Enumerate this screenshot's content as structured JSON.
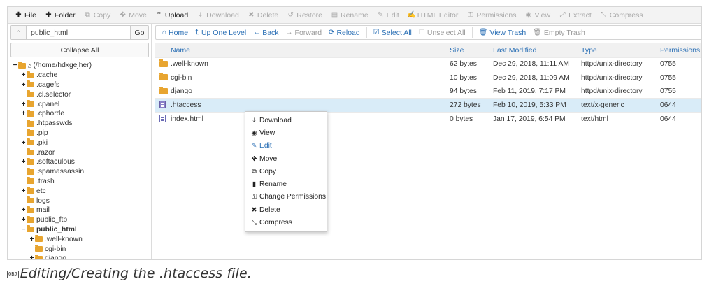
{
  "toolbar": {
    "items": [
      {
        "label": "File",
        "icon": "plus-icon",
        "glyph": "✚",
        "active": true
      },
      {
        "label": "Folder",
        "icon": "plus-icon",
        "glyph": "✚",
        "active": true
      },
      {
        "label": "Copy",
        "icon": "copy-icon",
        "glyph": "⧉",
        "active": false
      },
      {
        "label": "Move",
        "icon": "move-icon",
        "glyph": "✥",
        "active": false
      },
      {
        "label": "Upload",
        "icon": "upload-icon",
        "glyph": "⤒",
        "active": true
      },
      {
        "label": "Download",
        "icon": "download-icon",
        "glyph": "⤓",
        "active": false
      },
      {
        "label": "Delete",
        "icon": "delete-icon",
        "glyph": "✖",
        "active": false
      },
      {
        "label": "Restore",
        "icon": "restore-icon",
        "glyph": "↺",
        "active": false
      },
      {
        "label": "Rename",
        "icon": "rename-icon",
        "glyph": "▤",
        "active": false
      },
      {
        "label": "Edit",
        "icon": "edit-icon",
        "glyph": "✎",
        "active": false
      },
      {
        "label": "HTML Editor",
        "icon": "html-editor-icon",
        "glyph": "✍",
        "active": false
      },
      {
        "label": "Permissions",
        "icon": "key-icon",
        "glyph": "⚿",
        "active": false
      },
      {
        "label": "View",
        "icon": "eye-icon",
        "glyph": "◉",
        "active": false
      },
      {
        "label": "Extract",
        "icon": "extract-icon",
        "glyph": "⤢",
        "active": false
      },
      {
        "label": "Compress",
        "icon": "compress-icon",
        "glyph": "⤡",
        "active": false
      }
    ]
  },
  "left": {
    "path_value": "public_html",
    "go_label": "Go",
    "collapse_label": "Collapse All",
    "tree": [
      {
        "label": "(/home/hdxgejher)",
        "toggle": "−",
        "level": 0,
        "home": true,
        "bold": false
      },
      {
        "label": ".cache",
        "toggle": "+",
        "level": 1,
        "bold": false
      },
      {
        "label": ".cagefs",
        "toggle": "+",
        "level": 1,
        "bold": false
      },
      {
        "label": ".cl.selector",
        "toggle": "",
        "level": 1,
        "bold": false
      },
      {
        "label": ".cpanel",
        "toggle": "+",
        "level": 1,
        "bold": false
      },
      {
        "label": ".cphorde",
        "toggle": "+",
        "level": 1,
        "bold": false
      },
      {
        "label": ".htpasswds",
        "toggle": "",
        "level": 1,
        "bold": false
      },
      {
        "label": ".pip",
        "toggle": "",
        "level": 1,
        "bold": false
      },
      {
        "label": ".pki",
        "toggle": "+",
        "level": 1,
        "bold": false
      },
      {
        "label": ".razor",
        "toggle": "",
        "level": 1,
        "bold": false
      },
      {
        "label": ".softaculous",
        "toggle": "+",
        "level": 1,
        "bold": false
      },
      {
        "label": ".spamassassin",
        "toggle": "",
        "level": 1,
        "bold": false
      },
      {
        "label": ".trash",
        "toggle": "",
        "level": 1,
        "bold": false
      },
      {
        "label": "etc",
        "toggle": "+",
        "level": 1,
        "bold": false
      },
      {
        "label": "logs",
        "toggle": "",
        "level": 1,
        "bold": false
      },
      {
        "label": "mail",
        "toggle": "+",
        "level": 1,
        "bold": false
      },
      {
        "label": "public_ftp",
        "toggle": "+",
        "level": 1,
        "bold": false
      },
      {
        "label": "public_html",
        "toggle": "−",
        "level": 1,
        "bold": true
      },
      {
        "label": ".well-known",
        "toggle": "+",
        "level": 2,
        "bold": false
      },
      {
        "label": "cgi-bin",
        "toggle": "",
        "level": 2,
        "bold": false
      },
      {
        "label": "django",
        "toggle": "+",
        "level": 2,
        "bold": false
      }
    ]
  },
  "nav": {
    "items": [
      {
        "label": "Home",
        "icon": "home-icon",
        "glyph": "⌂",
        "enabled": true
      },
      {
        "label": "Up One Level",
        "icon": "up-level-icon",
        "glyph": "⮤",
        "enabled": true
      },
      {
        "label": "Back",
        "icon": "back-arrow-icon",
        "glyph": "←",
        "enabled": true
      },
      {
        "label": "Forward",
        "icon": "forward-arrow-icon",
        "glyph": "→",
        "enabled": false
      },
      {
        "label": "Reload",
        "icon": "reload-icon",
        "glyph": "⟳",
        "enabled": true
      },
      {
        "label": "Select All",
        "icon": "checkbox-checked-icon",
        "glyph": "☑",
        "enabled": true
      },
      {
        "label": "Unselect All",
        "icon": "checkbox-empty-icon",
        "glyph": "☐",
        "enabled": false
      },
      {
        "label": "View Trash",
        "icon": "trash-icon",
        "glyph": "🗑",
        "enabled": true
      },
      {
        "label": "Empty Trash",
        "icon": "trash-icon",
        "glyph": "🗑",
        "enabled": false
      }
    ]
  },
  "table": {
    "headers": {
      "name": "Name",
      "size": "Size",
      "modified": "Last Modified",
      "type": "Type",
      "permissions": "Permissions"
    },
    "rows": [
      {
        "icon": "folder",
        "name": ".well-known",
        "size": "62 bytes",
        "modified": "Dec 29, 2018, 11:11 AM",
        "type": "httpd/unix-directory",
        "perm": "0755",
        "selected": false
      },
      {
        "icon": "folder",
        "name": "cgi-bin",
        "size": "10 bytes",
        "modified": "Dec 29, 2018, 11:09 AM",
        "type": "httpd/unix-directory",
        "perm": "0755",
        "selected": false
      },
      {
        "icon": "folder",
        "name": "django",
        "size": "94 bytes",
        "modified": "Feb 11, 2019, 7:17 PM",
        "type": "httpd/unix-directory",
        "perm": "0755",
        "selected": false
      },
      {
        "icon": "text-file",
        "name": ".htaccess",
        "size": "272 bytes",
        "modified": "Feb 10, 2019, 5:33 PM",
        "type": "text/x-generic",
        "perm": "0644",
        "selected": true
      },
      {
        "icon": "html-file",
        "name": "index.html",
        "size": "0 bytes",
        "modified": "Jan 17, 2019, 6:54 PM",
        "type": "text/html",
        "perm": "0644",
        "selected": false
      }
    ]
  },
  "context_menu": {
    "items": [
      {
        "label": "Download",
        "icon": "download-icon",
        "glyph": "⤓",
        "highlight": false
      },
      {
        "label": "View",
        "icon": "eye-icon",
        "glyph": "◉",
        "highlight": false
      },
      {
        "label": "Edit",
        "icon": "edit-icon",
        "glyph": "✎",
        "highlight": true
      },
      {
        "label": "Move",
        "icon": "move-icon",
        "glyph": "✥",
        "highlight": false
      },
      {
        "label": "Copy",
        "icon": "copy-icon",
        "glyph": "⧉",
        "highlight": false
      },
      {
        "label": "Rename",
        "icon": "rename-icon",
        "glyph": "▮",
        "highlight": false
      },
      {
        "label": "Change Permissions",
        "icon": "key-icon",
        "glyph": "⚿",
        "highlight": false
      },
      {
        "label": "Delete",
        "icon": "delete-icon",
        "glyph": "✖",
        "highlight": false
      },
      {
        "label": "Compress",
        "icon": "compress-icon",
        "glyph": "⤡",
        "highlight": false
      }
    ]
  },
  "caption": {
    "badge": "OBJ",
    "text": "Editing/Creating the .htaccess file."
  },
  "colors": {
    "link_blue": "#2a6fb5",
    "folder_orange": "#e8a530",
    "selected_row": "#d9ecf8"
  }
}
